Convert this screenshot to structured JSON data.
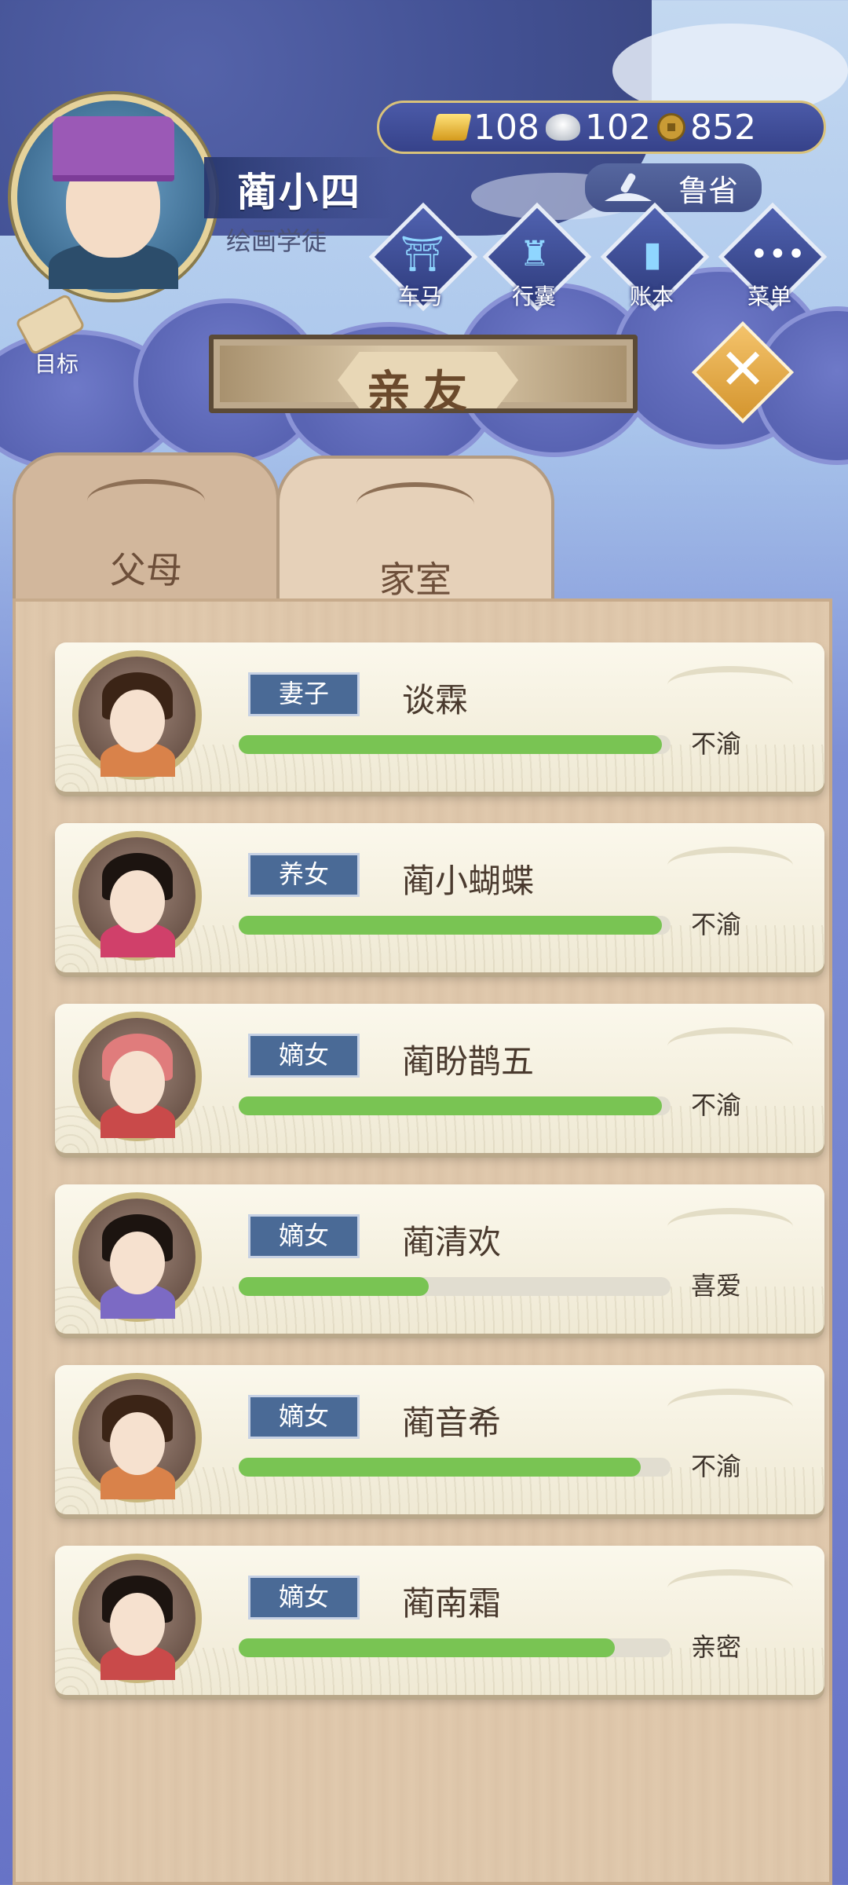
{
  "player": {
    "name": "蔺小四",
    "title": "绘画学徒"
  },
  "currency": {
    "gold": "108",
    "silver": "102",
    "coins": "852"
  },
  "region": "鲁省",
  "menu": [
    {
      "label": "车马",
      "icon": "carriage-icon"
    },
    {
      "label": "行囊",
      "icon": "bag-icon"
    },
    {
      "label": "账本",
      "icon": "ledger-icon"
    },
    {
      "label": "菜单",
      "icon": "more-icon"
    }
  ],
  "target_label": "目标",
  "header_title": "亲友",
  "tabs": [
    {
      "label": "父母",
      "active": false
    },
    {
      "label": "家室",
      "active": true
    }
  ],
  "relatives": [
    {
      "role": "妻子",
      "name": "谈霖",
      "mood": "不渝",
      "affection": 0.98,
      "hair": "#3b2416",
      "clothes": "#d9824a"
    },
    {
      "role": "养女",
      "name": "蔺小蝴蝶",
      "mood": "不渝",
      "affection": 0.98,
      "hair": "#1c1410",
      "clothes": "#d0406a"
    },
    {
      "role": "嫡女",
      "name": "蔺盼鹊五",
      "mood": "不渝",
      "affection": 0.98,
      "hair": "#e07c7c",
      "clothes": "#c94a4a"
    },
    {
      "role": "嫡女",
      "name": "蔺清欢",
      "mood": "喜爱",
      "affection": 0.44,
      "hair": "#1c1410",
      "clothes": "#7c6ac4"
    },
    {
      "role": "嫡女",
      "name": "蔺音希",
      "mood": "不渝",
      "affection": 0.93,
      "hair": "#3b2416",
      "clothes": "#d9824a"
    },
    {
      "role": "嫡女",
      "name": "蔺南霜",
      "mood": "亲密",
      "affection": 0.87,
      "hair": "#1c1410",
      "clothes": "#c94a4a"
    }
  ],
  "colors": {
    "bar_fill": "#79c453",
    "role_tag": "#4a6a96",
    "panel": "#e0c9ad"
  }
}
